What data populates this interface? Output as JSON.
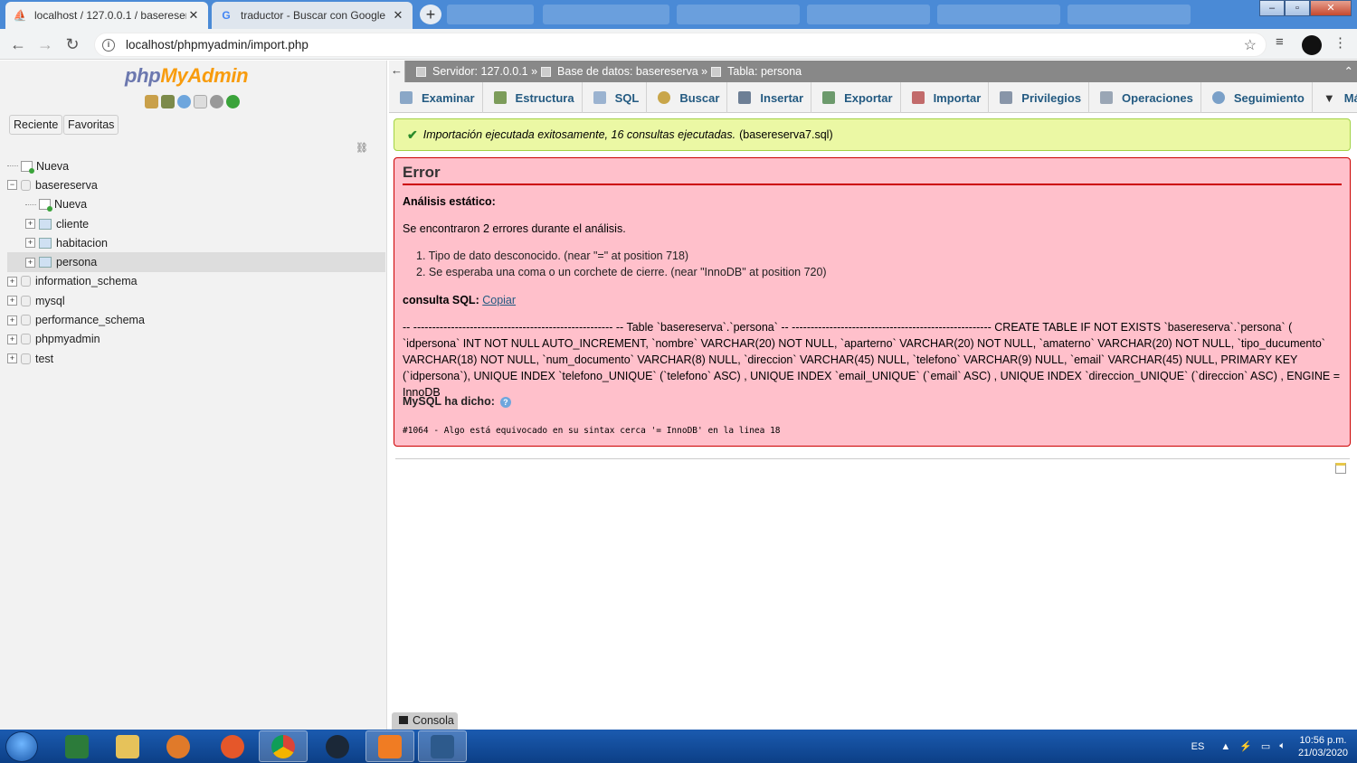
{
  "browser": {
    "tabs": [
      {
        "title": "localhost / 127.0.0.1 / basereserv",
        "active": true
      },
      {
        "title": "traductor - Buscar con Google",
        "active": false
      }
    ],
    "url": "localhost/phpmyadmin/import.php"
  },
  "nav_panel": {
    "logo_php": "php",
    "logo_my": "MyAdmin",
    "buttons": [
      "Reciente",
      "Favoritas"
    ],
    "tree": [
      {
        "label": "Nueva",
        "level": 0,
        "kind": "new"
      },
      {
        "label": "basereserva",
        "level": 0,
        "kind": "db",
        "expanded": true
      },
      {
        "label": "Nueva",
        "level": 1,
        "kind": "new"
      },
      {
        "label": "cliente",
        "level": 1,
        "kind": "table"
      },
      {
        "label": "habitacion",
        "level": 1,
        "kind": "table"
      },
      {
        "label": "persona",
        "level": 1,
        "kind": "table",
        "selected": true
      },
      {
        "label": "information_schema",
        "level": 0,
        "kind": "db"
      },
      {
        "label": "mysql",
        "level": 0,
        "kind": "db"
      },
      {
        "label": "performance_schema",
        "level": 0,
        "kind": "db"
      },
      {
        "label": "phpmyadmin",
        "level": 0,
        "kind": "db"
      },
      {
        "label": "test",
        "level": 0,
        "kind": "db"
      }
    ]
  },
  "breadcrumb": {
    "server": "Servidor: 127.0.0.1 »",
    "database": "Base de datos: basereserva »",
    "table": "Tabla: persona"
  },
  "menu": [
    {
      "label": "Examinar",
      "color": "#8aa7c7"
    },
    {
      "label": "Estructura",
      "color": "#7c9c5a"
    },
    {
      "label": "SQL",
      "color": "#9bb3d0"
    },
    {
      "label": "Buscar",
      "color": "#c9a64a"
    },
    {
      "label": "Insertar",
      "color": "#6d7f95"
    },
    {
      "label": "Exportar",
      "color": "#6c9a6c"
    },
    {
      "label": "Importar",
      "color": "#c26b6b"
    },
    {
      "label": "Privilegios",
      "color": "#8895a8"
    },
    {
      "label": "Operaciones",
      "color": "#9aa6b5"
    },
    {
      "label": "Seguimiento",
      "color": "#7aa0c8"
    },
    {
      "label": "Más",
      "color": "#333333"
    }
  ],
  "success": {
    "message": "Importación ejecutada exitosamente, 16 consultas ejecutadas.",
    "file": "(basereserva7.sql)"
  },
  "error": {
    "title": "Error",
    "static_analysis": "Análisis estático:",
    "summary": "Se encontraron 2 errores durante el análisis.",
    "errors": [
      "1. Tipo de dato desconocido. (near \"=\" at position 718)",
      "2. Se esperaba una coma o un corchete de cierre. (near \"InnoDB\" at position 720)"
    ],
    "sql_label": "consulta SQL:",
    "copy_link": "Copiar",
    "sql": "-- ----------------------------------------------------- -- Table `basereserva`.`persona` -- ----------------------------------------------------- CREATE TABLE IF NOT EXISTS `basereserva`.`persona` ( `idpersona` INT NOT NULL AUTO_INCREMENT, `nombre` VARCHAR(20) NOT NULL, `aparterno` VARCHAR(20) NOT NULL, `amaterno` VARCHAR(20) NOT NULL, `tipo_ducumento` VARCHAR(18) NOT NULL, `num_documento` VARCHAR(8) NULL, `direccion` VARCHAR(45) NULL, `telefono` VARCHAR(9) NULL, `email` VARCHAR(45) NULL, PRIMARY KEY (`idpersona`), UNIQUE INDEX `telefono_UNIQUE` (`telefono` ASC) , UNIQUE INDEX `email_UNIQUE` (`email` ASC) , UNIQUE INDEX `direccion_UNIQUE` (`direccion` ASC) , ENGINE = InnoDB",
    "mysql_label": "MySQL ha dicho:",
    "mysql_message": "#1064 - Algo está equivocado en su sintax cerca '= InnoDB' en la linea 18"
  },
  "console_label": "Consola",
  "taskbar": {
    "lang": "ES",
    "time": "10:56 p.m.",
    "date": "21/03/2020"
  }
}
